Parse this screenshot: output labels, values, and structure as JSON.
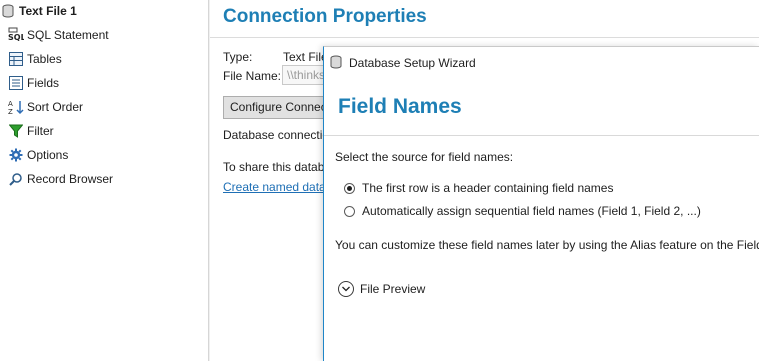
{
  "sidebar": {
    "root": {
      "label": "Text File 1",
      "icon": "database-icon"
    },
    "items": [
      {
        "label": "SQL Statement",
        "icon": "sql-icon"
      },
      {
        "label": "Tables",
        "icon": "table-icon"
      },
      {
        "label": "Fields",
        "icon": "fields-icon"
      },
      {
        "label": "Sort Order",
        "icon": "sort-az-icon"
      },
      {
        "label": "Filter",
        "icon": "filter-icon"
      },
      {
        "label": "Options",
        "icon": "gear-icon"
      },
      {
        "label": "Record Browser",
        "icon": "magnifier-icon"
      }
    ]
  },
  "main": {
    "title": "Connection Properties",
    "type_label": "Type:",
    "type_value": "Text File",
    "file_name_label": "File Name:",
    "file_name_value": "\\\\thinks",
    "configure_button": "Configure Connection",
    "database_connection_text": "Database connection",
    "share_text": "To share this database",
    "create_link": "Create named data"
  },
  "wizard": {
    "title": "Database Setup Wizard",
    "heading": "Field Names",
    "prompt": "Select the source for field names:",
    "options": [
      {
        "label": "The first row is a header containing field names",
        "checked": true
      },
      {
        "label": "Automatically assign sequential field names (Field 1, Field 2, ...)",
        "checked": false
      }
    ],
    "note": "You can customize these field names later by using the Alias feature on the Fields",
    "file_preview": "File Preview"
  },
  "colors": {
    "accent": "#1e7fb5",
    "link": "#1e6fb5",
    "filter_green": "#2e9e2e",
    "options_blue": "#2f6db5"
  }
}
